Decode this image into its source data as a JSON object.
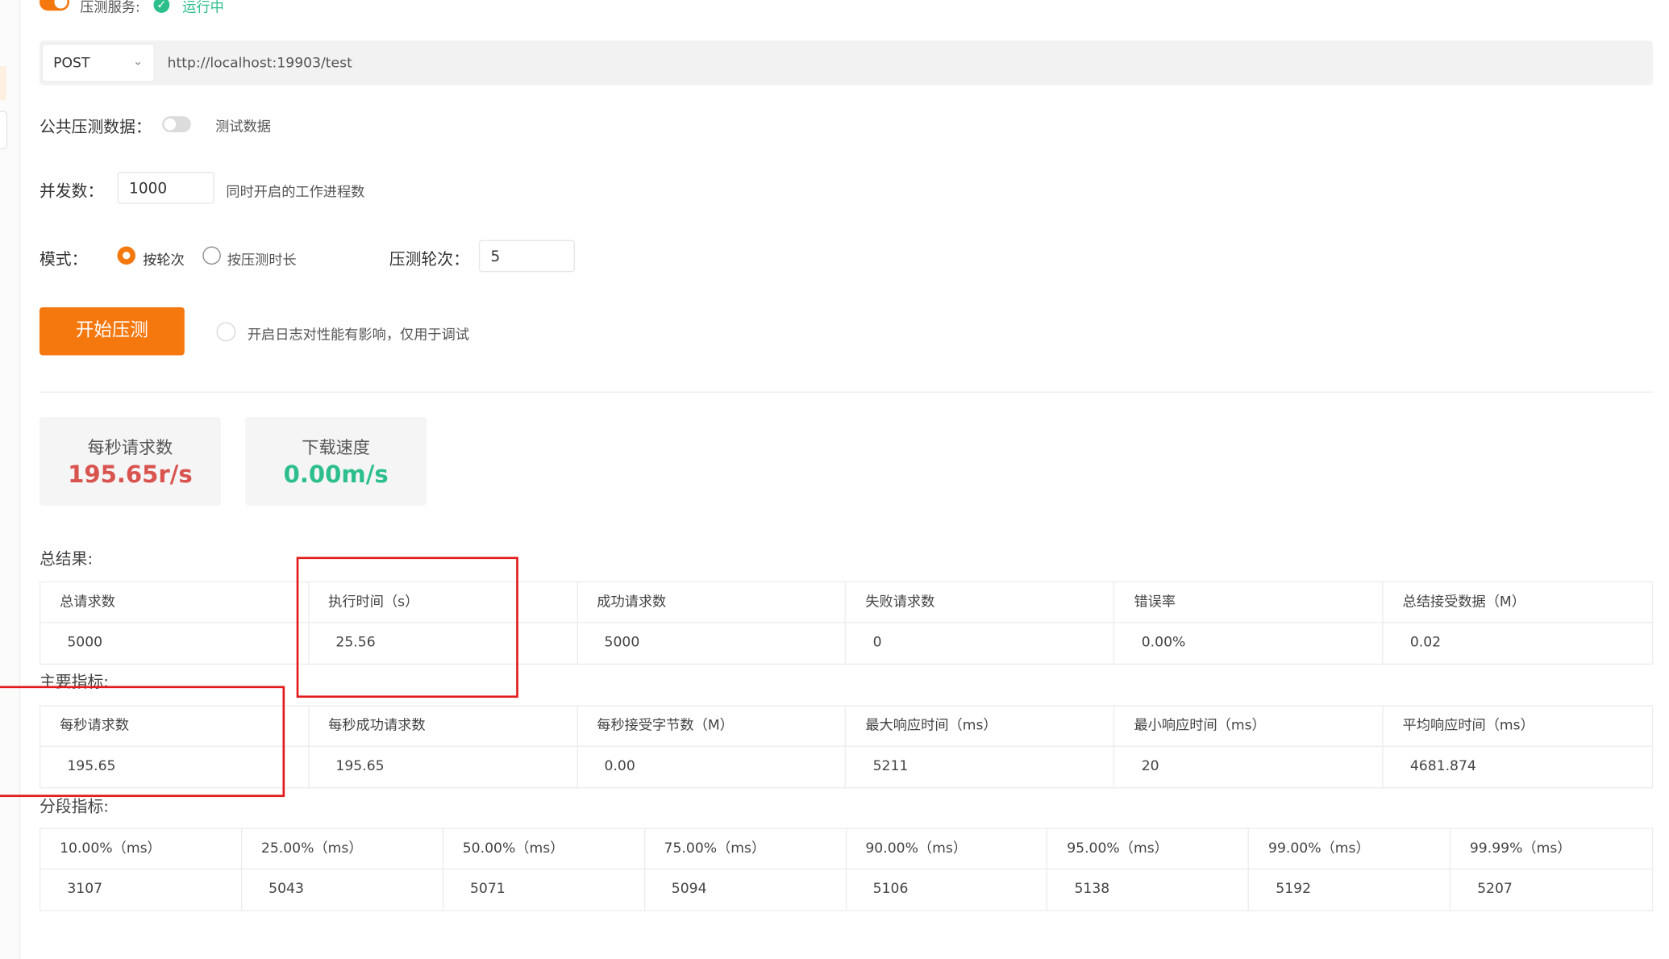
{
  "service": {
    "label": "压测服务:",
    "status": "运行中",
    "toggle_on": true
  },
  "request": {
    "method": "POST",
    "url": "http://localhost:19903/test"
  },
  "public_data": {
    "label": "公共压测数据：",
    "hint": "测试数据",
    "toggle_on": false
  },
  "concurrency": {
    "label": "并发数：",
    "value": "1000",
    "hint": "同时开启的工作进程数"
  },
  "mode": {
    "label": "模式：",
    "options": [
      "按轮次",
      "按压测时长"
    ],
    "selected": "按轮次",
    "rounds_label": "压测轮次：",
    "rounds_value": "5"
  },
  "actions": {
    "start_label": "开始压测",
    "log_hint": "开启日志对性能有影响，仅用于调试"
  },
  "stats": [
    {
      "title": "每秒请求数",
      "value": "195.65r/s",
      "color": "#d9534f"
    },
    {
      "title": "下载速度",
      "value": "0.00m/s",
      "color": "#2cbf8c"
    }
  ],
  "summary": {
    "label": "总结果:",
    "headers": [
      "总请求数",
      "执行时间（s）",
      "成功请求数",
      "失败请求数",
      "错误率",
      "总结接受数据（M）"
    ],
    "values": [
      "5000",
      "25.56",
      "5000",
      "0",
      "0.00%",
      "0.02"
    ]
  },
  "main_metrics": {
    "label": "主要指标:",
    "headers": [
      "每秒请求数",
      "每秒成功请求数",
      "每秒接受字节数（M）",
      "最大响应时间（ms）",
      "最小响应时间（ms）",
      "平均响应时间（ms）"
    ],
    "values": [
      "195.65",
      "195.65",
      "0.00",
      "5211",
      "20",
      "4681.874"
    ]
  },
  "percentiles": {
    "label": "分段指标:",
    "headers": [
      "10.00%（ms）",
      "25.00%（ms）",
      "50.00%（ms）",
      "75.00%（ms）",
      "90.00%（ms）",
      "95.00%（ms）",
      "99.00%（ms）",
      "99.99%（ms）"
    ],
    "values": [
      "3107",
      "5043",
      "5071",
      "5094",
      "5106",
      "5138",
      "5192",
      "5207"
    ]
  },
  "colors": {
    "accent": "#f5780f",
    "success": "#2cbf8c",
    "highlight_box": "#e31a1a"
  }
}
